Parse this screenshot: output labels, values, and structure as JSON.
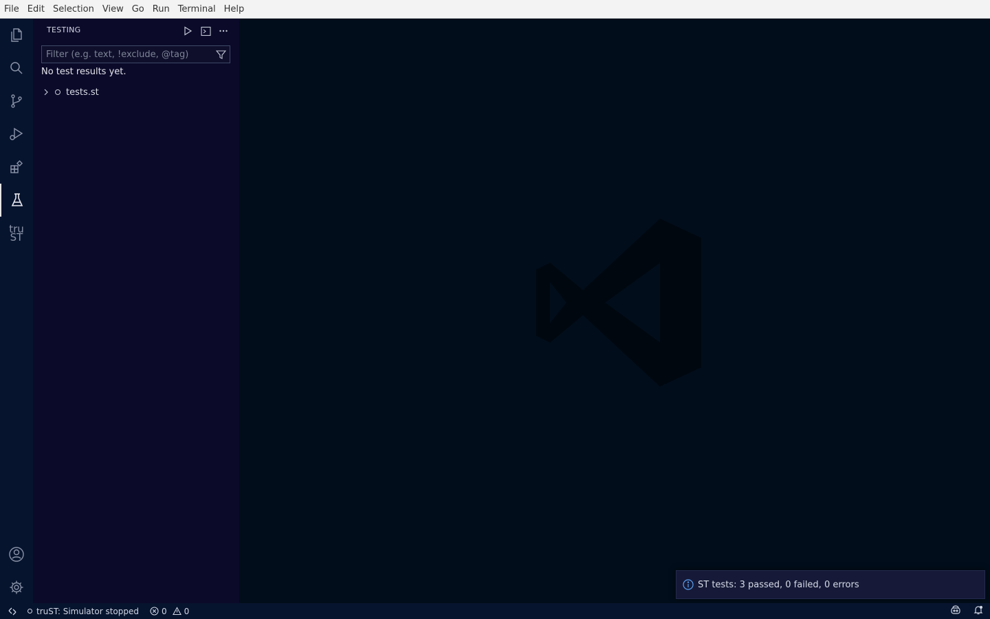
{
  "menu": [
    "File",
    "Edit",
    "Selection",
    "View",
    "Go",
    "Run",
    "Terminal",
    "Help"
  ],
  "activity_bar": {
    "items": [
      "files-icon",
      "search-icon",
      "source-control-icon",
      "run-debug-icon",
      "extensions-icon",
      "testing-icon",
      "trust-icon"
    ],
    "active": "testing-icon",
    "trust_label_top": "tru",
    "trust_label_bottom": "ST",
    "bottom": [
      "account-icon",
      "settings-gear-icon"
    ]
  },
  "sidebar": {
    "title": "TESTING",
    "filter_placeholder": "Filter (e.g. text, !exclude, @tag)",
    "filter_value": "",
    "no_results": "No test results yet.",
    "tree": [
      {
        "label": "tests.st"
      }
    ]
  },
  "notification": {
    "message": "ST tests: 3 passed, 0 failed, 0 errors"
  },
  "statusbar": {
    "simulator": "truST: Simulator stopped",
    "errors": "0",
    "warnings": "0"
  },
  "colors": {
    "editor_bg": "#010d1a",
    "sidebar_bg": "#0b0a29",
    "activitybar_bg": "#07142e"
  }
}
